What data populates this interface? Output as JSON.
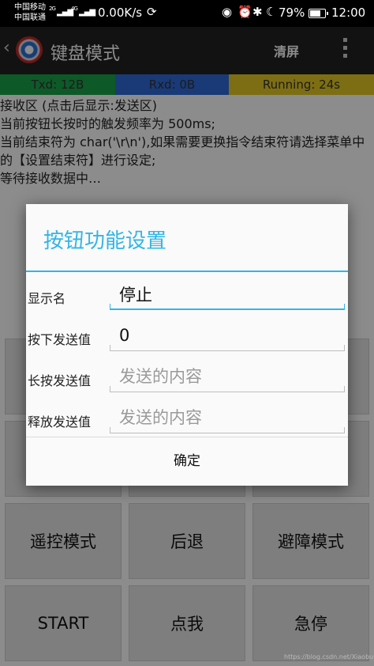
{
  "status_bar": {
    "carrier_1": "中国移动",
    "carrier_2": "中国联通",
    "net_1": "2G",
    "net_2": "4G",
    "speed": "0.00K/s",
    "battery_percent": "79%",
    "battery_level": 0.79,
    "time": "12:00"
  },
  "app_bar": {
    "title": "键盘模式",
    "clear_label": "清屏"
  },
  "counters": {
    "txd": "Txd: 12B",
    "rxd": "Rxd: 0B",
    "running": "Running: 24s"
  },
  "receive": {
    "header": "接收区  (点击后显示:发送区)",
    "line_1": "当前按钮长按时的触发频率为 500ms;",
    "line_2": "当前结束符为 char('\\r\\n'),如果需要更换指令结束符请选择菜单中的【设置结束符】进行设定;",
    "line_3": "等待接收数据中…"
  },
  "grid": {
    "row3": [
      "遥控模式",
      "后退",
      "避障模式"
    ],
    "row4": [
      "START",
      "点我",
      "急停"
    ]
  },
  "dialog": {
    "title": "按钮功能设置",
    "fields": [
      {
        "label": "显示名",
        "value": "停止",
        "placeholder": ""
      },
      {
        "label": "按下发送值",
        "value": "0",
        "placeholder": ""
      },
      {
        "label": "长按发送值",
        "value": "",
        "placeholder": "发送的内容"
      },
      {
        "label": "释放发送值",
        "value": "",
        "placeholder": "发送的内容"
      }
    ],
    "confirm_label": "确定"
  },
  "watermark": "https://blog.csdn.net/Xiaobu0222",
  "colors": {
    "accent": "#33b5e5",
    "txd_bg": "#1aa34a",
    "rxd_bg": "#2e6bd9",
    "running_bg": "#e4c825"
  }
}
